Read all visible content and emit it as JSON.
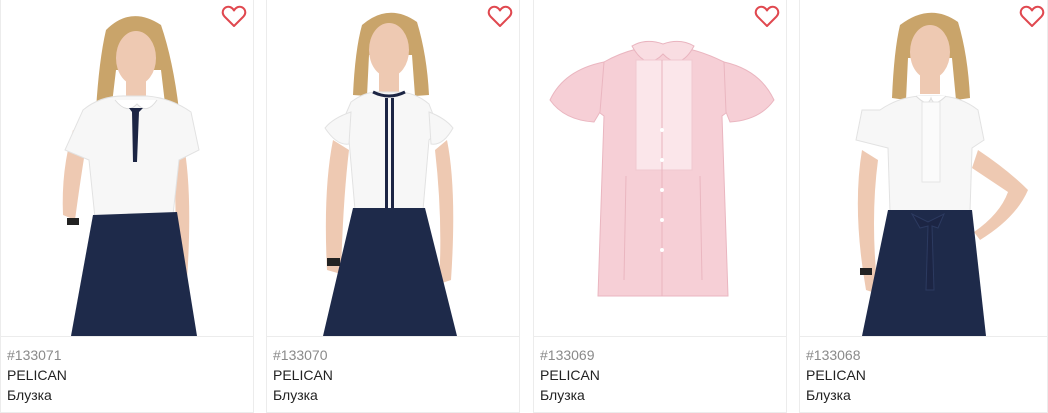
{
  "colors": {
    "heart": "#e0484f",
    "skirt": "#1e2a4a",
    "shirt_white": "#f7f7f7",
    "shirt_pink": "#f6cfd6",
    "hair": "#c9a46a",
    "skin": "#eec9b2",
    "ribbon": "#1c2544"
  },
  "products": [
    {
      "sku": "#133071",
      "brand": "PELICAN",
      "name": "Блузка",
      "image": "girl-white-blouse-bow-tie",
      "favorite_icon": "heart-outline-icon"
    },
    {
      "sku": "#133070",
      "brand": "PELICAN",
      "name": "Блузка",
      "image": "girl-white-blouse-navy-trim",
      "favorite_icon": "heart-outline-icon"
    },
    {
      "sku": "#133069",
      "brand": "PELICAN",
      "name": "Блузка",
      "image": "pink-blouse-flat",
      "favorite_icon": "heart-outline-icon"
    },
    {
      "sku": "#133068",
      "brand": "PELICAN",
      "name": "Блузка",
      "image": "girl-white-blouse-ruffle",
      "favorite_icon": "heart-outline-icon"
    }
  ]
}
